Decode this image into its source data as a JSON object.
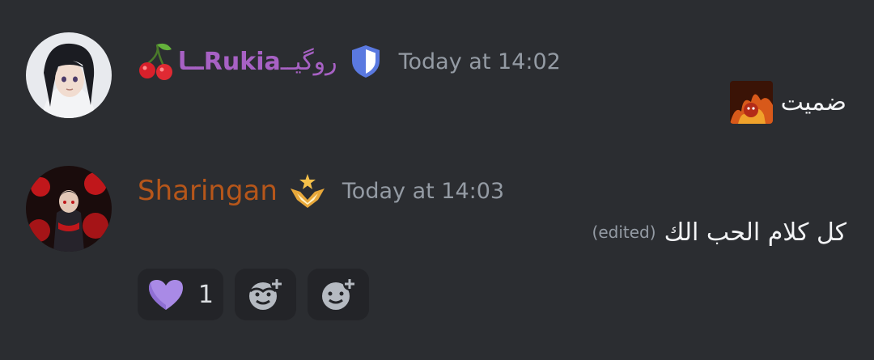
{
  "messages": [
    {
      "username_rtl": "روگيــ",
      "username_latin": "Rukia",
      "username_tail": "ــا",
      "username_color": "#a761c4",
      "timestamp": "Today at 14:02",
      "text": "ضميت",
      "badge_icon": "shield-icon",
      "decoration_icon": "cherry-icon",
      "avatar": "rukia-anime-avatar"
    },
    {
      "username": "Sharingan",
      "username_color": "#b6561a",
      "timestamp": "Today at 14:03",
      "text": "كل كلام الحب الك",
      "edited_label": "(edited)",
      "badge_icon": "crown-star-icon",
      "avatar": "itachi-anime-avatar"
    }
  ],
  "reactions": [
    {
      "icon": "purple-heart-icon",
      "count": "1"
    },
    {
      "icon": "add-reaction-icon"
    },
    {
      "icon": "add-super-reaction-icon"
    }
  ]
}
